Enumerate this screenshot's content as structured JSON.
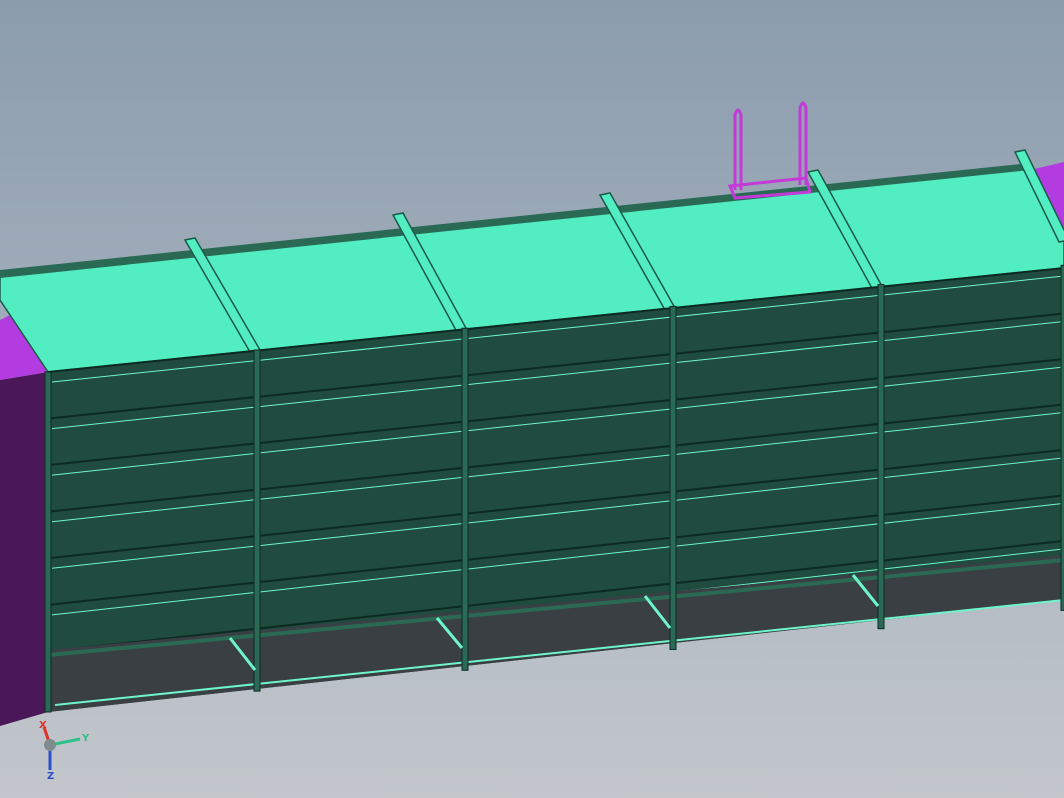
{
  "window": {
    "title": ""
  },
  "model": {
    "type": "3D CAD model viewport",
    "colors": {
      "background_top": "#8b9cad",
      "background_bottom": "#c3c7cc",
      "top_panel": "#52eec2",
      "top_panel_edge": "#1a5a48",
      "shelf_front": "#1f4c3f",
      "shelf_highlight": "#6ff5cc",
      "frame": "#2a6a55",
      "side_panel": "#4a1858",
      "side_panel_accent": "#b33ce0",
      "handle": "#c43ad8",
      "cavity": "#3a3f43"
    },
    "bays": 5,
    "shelf_rows": 6
  },
  "triad": {
    "x_label": "X",
    "y_label": "Y",
    "z_label": "Z",
    "x_color": "#e0302a",
    "y_color": "#2ec08a",
    "z_color": "#2b4fc8"
  }
}
